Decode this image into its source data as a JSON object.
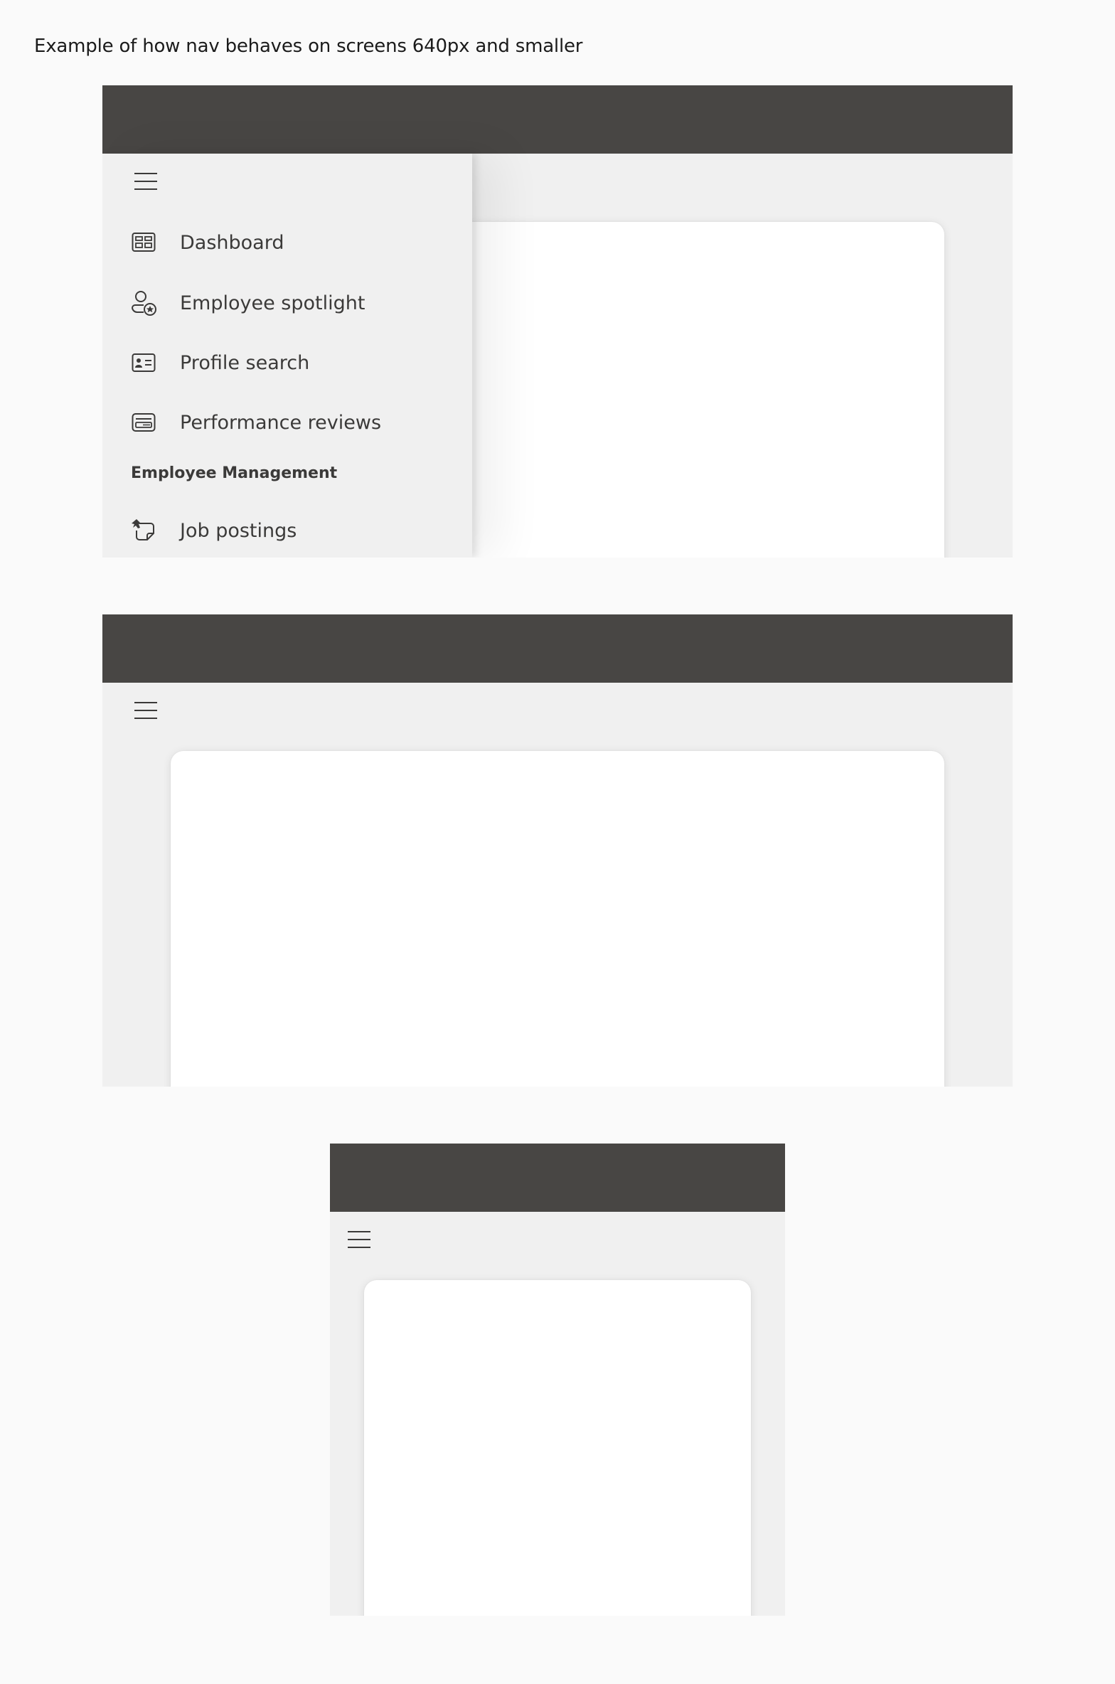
{
  "caption": "Example of how nav behaves on screens 640px and smaller",
  "colors": {
    "page_background": "#fafafa",
    "frame_background": "#f0f0f0",
    "header_bar": "#484644",
    "card": "#ffffff",
    "text": "#3b3a39",
    "icon_stroke": "#3b3a39"
  },
  "nav": {
    "toggle_icon": "hamburger-menu-icon",
    "items": [
      {
        "label": "Dashboard",
        "icon": "dashboard-icon"
      },
      {
        "label": "Employee spotlight",
        "icon": "person-star-icon"
      },
      {
        "label": "Profile search",
        "icon": "contact-card-icon"
      },
      {
        "label": "Performance reviews",
        "icon": "review-card-icon"
      }
    ],
    "section_header": "Employee Management",
    "section_items": [
      {
        "label": "Job postings",
        "icon": "pinned-note-icon"
      }
    ]
  },
  "examples": [
    {
      "state": "nav-expanded-overlay"
    },
    {
      "state": "nav-collapsed"
    },
    {
      "state": "nav-collapsed-narrow"
    }
  ]
}
